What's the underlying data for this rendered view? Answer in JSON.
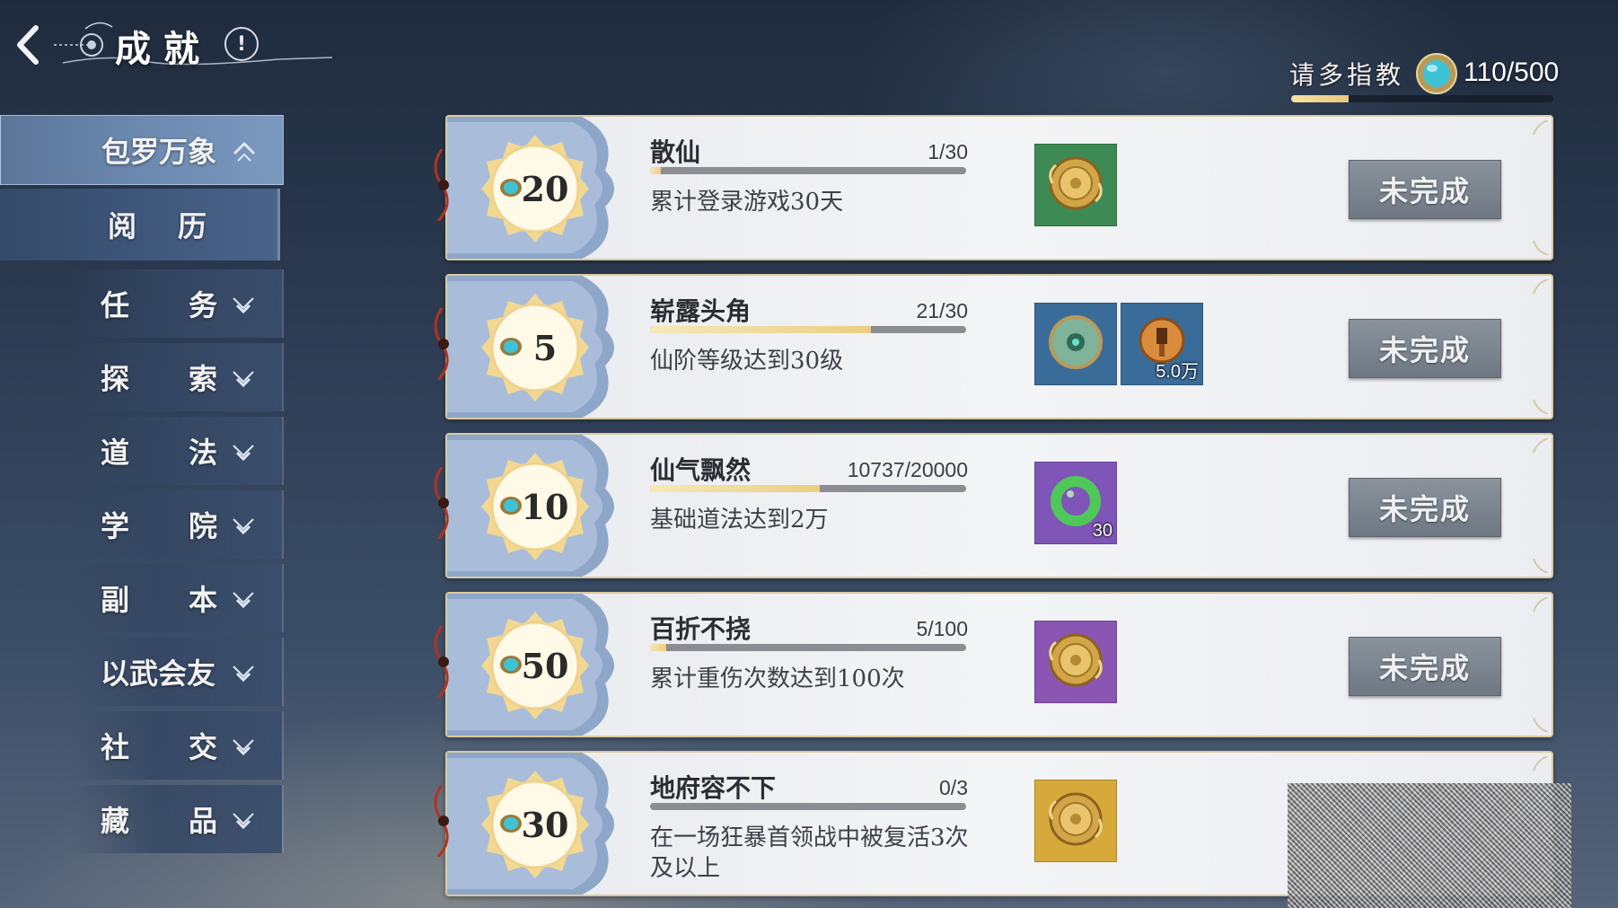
{
  "header": {
    "title": "成就",
    "info_icon": "!",
    "rank_label": "请多指教",
    "points": "110/500",
    "points_progress": 0.22
  },
  "sidebar": {
    "items": [
      {
        "label": "包罗万象",
        "state": "expanded-active"
      },
      {
        "label": "阅历",
        "state": "sub-selected"
      },
      {
        "label": "任务",
        "state": "collapsed"
      },
      {
        "label": "探索",
        "state": "collapsed"
      },
      {
        "label": "道法",
        "state": "collapsed"
      },
      {
        "label": "学院",
        "state": "collapsed"
      },
      {
        "label": "副本",
        "state": "collapsed"
      },
      {
        "label": "以武会友",
        "state": "collapsed"
      },
      {
        "label": "社交",
        "state": "collapsed"
      },
      {
        "label": "藏品",
        "state": "collapsed"
      }
    ]
  },
  "achievements": [
    {
      "points": "20",
      "name": "散仙",
      "progress": "1/30",
      "progress_ratio": 0.033,
      "desc": "累计登录游戏30天",
      "rewards": [
        {
          "icon": "gold-medallion-icon",
          "bg": "#3d8a55",
          "count": ""
        }
      ],
      "status": "未完成"
    },
    {
      "points": "5",
      "name": "崭露头角",
      "progress": "21/30",
      "progress_ratio": 0.7,
      "desc": "仙阶等级达到30级",
      "rewards": [
        {
          "icon": "jade-disc-icon",
          "bg": "#3a6c9a",
          "count": ""
        },
        {
          "icon": "copper-coin-icon",
          "bg": "#3a6c9a",
          "count": "5.0万"
        }
      ],
      "status": "未完成"
    },
    {
      "points": "10",
      "name": "仙气飘然",
      "progress": "10737/20000",
      "progress_ratio": 0.537,
      "desc": "基础道法达到2万",
      "rewards": [
        {
          "icon": "jade-ring-icon",
          "bg": "#7f55b8",
          "count": "30"
        }
      ],
      "status": "未完成"
    },
    {
      "points": "50",
      "name": "百折不挠",
      "progress": "5/100",
      "progress_ratio": 0.05,
      "desc": "累计重伤次数达到100次",
      "rewards": [
        {
          "icon": "gold-medallion-icon",
          "bg": "#8a55b3",
          "count": ""
        }
      ],
      "status": "未完成"
    },
    {
      "points": "30",
      "name": "地府容不下",
      "progress": "0/3",
      "progress_ratio": 0.0,
      "desc": "在一场狂暴首领战中被复活3次及以上",
      "rewards": [
        {
          "icon": "gold-medallion-icon",
          "bg": "#d6a93a",
          "count": ""
        }
      ],
      "status": ""
    }
  ],
  "colors": {
    "accent_gold": "#e9cf84",
    "button_gray": "#7b848d",
    "card_bg": "#eff0f3"
  }
}
